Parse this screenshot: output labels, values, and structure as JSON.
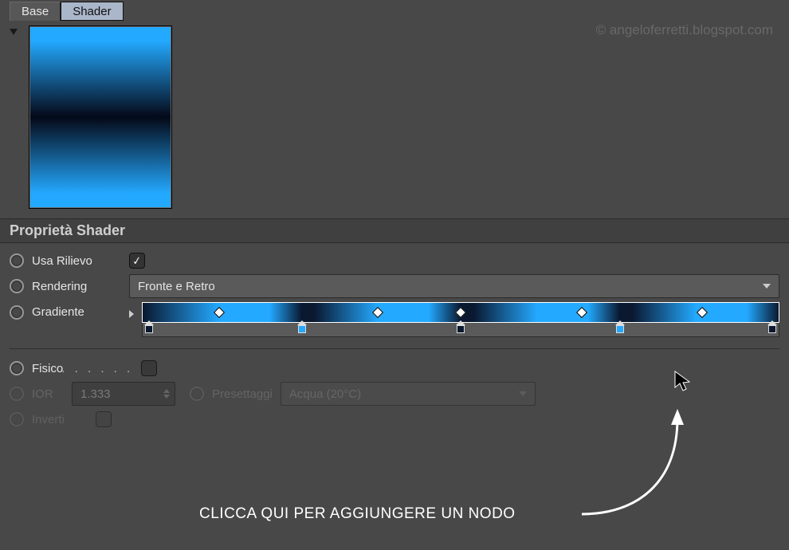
{
  "tabs": {
    "base": "Base",
    "shader": "Shader"
  },
  "watermark": "© angeloferretti.blogspot.com",
  "section_title": "Proprietà Shader",
  "props": {
    "usa_rilievo": "Usa Rilievo",
    "rendering": "Rendering",
    "rendering_value": "Fronte e Retro",
    "gradiente": "Gradiente",
    "fisico": "Fisico",
    "ior": "IOR",
    "ior_value": "1.333",
    "presettaggi": "Presettaggi",
    "presettaggi_value": "Acqua (20°C)",
    "inverti": "Inverti"
  },
  "gradient": {
    "knots_pct": [
      12,
      37,
      50,
      69,
      88
    ],
    "stops": [
      {
        "pos_pct": 1,
        "color": "#0a1830"
      },
      {
        "pos_pct": 25,
        "color": "#23a9ff"
      },
      {
        "pos_pct": 50,
        "color": "#0a1830"
      },
      {
        "pos_pct": 75,
        "color": "#23a9ff"
      },
      {
        "pos_pct": 99,
        "color": "#0a1830"
      }
    ]
  },
  "annotation": "CLICCA QUI PER AGGIUNGERE UN NODO"
}
